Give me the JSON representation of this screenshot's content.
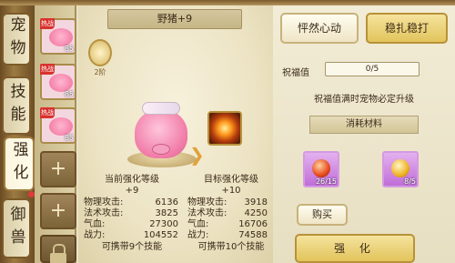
{
  "tabs": [
    {
      "label": "宠物"
    },
    {
      "label": "技能"
    },
    {
      "label": "强化"
    },
    {
      "label": "御兽"
    }
  ],
  "pet_list": [
    {
      "badge": "热战",
      "level": "85"
    },
    {
      "badge": "热战",
      "level": "85"
    },
    {
      "badge": "热战",
      "level": "85"
    }
  ],
  "pet": {
    "name": "野猪+9",
    "rank_badge": "",
    "rank_sub": "2阶"
  },
  "current": {
    "title": "当前强化等级",
    "level": "+9",
    "stats": [
      {
        "label": "物理攻击:",
        "value": "6136"
      },
      {
        "label": "法术攻击:",
        "value": "3825"
      },
      {
        "label": "气血:",
        "value": "27300"
      },
      {
        "label": "战力:",
        "value": "104552"
      }
    ],
    "skill_note": "可携带9个技能"
  },
  "target": {
    "title": "目标强化等级",
    "level": "+10",
    "stats": [
      {
        "label": "物理攻击:",
        "value": "3918"
      },
      {
        "label": "法术攻击:",
        "value": "4250"
      },
      {
        "label": "气血:",
        "value": "16706"
      },
      {
        "label": "战力:",
        "value": "74588"
      }
    ],
    "skill_note": "可携带10个技能"
  },
  "right": {
    "btn_left": "怦然心动",
    "btn_right": "稳扎稳打",
    "blessing_label": "祝福值",
    "blessing_value": "0/5",
    "note": "祝福值满时宠物必定升级",
    "consume_title": "消耗材料",
    "items": [
      {
        "name": "red-gem",
        "count": "26/15"
      },
      {
        "name": "gold-gem",
        "count": "8/5"
      }
    ],
    "buy": "购买",
    "enhance": "强 化"
  },
  "colors": {
    "accent_gold": "#e2c45c",
    "frame": "#6a4a22",
    "tab_active": "#fffbea"
  }
}
